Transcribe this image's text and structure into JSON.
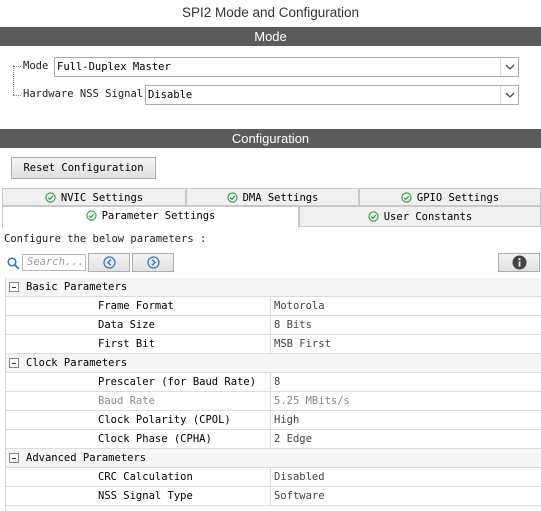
{
  "window": {
    "title": "SPI2 Mode and Configuration"
  },
  "mode_section": {
    "header": "Mode",
    "mode_label": "Mode",
    "mode_value": "Full-Duplex Master",
    "nss_label": "Hardware NSS Signal",
    "nss_value": "Disable"
  },
  "config_section": {
    "header": "Configuration",
    "reset_button": "Reset Configuration",
    "tabs_top": [
      {
        "label": "NVIC Settings"
      },
      {
        "label": "DMA Settings"
      },
      {
        "label": "GPIO Settings"
      }
    ],
    "tabs_bottom": [
      {
        "label": "Parameter Settings",
        "active": true
      },
      {
        "label": "User Constants",
        "active": false
      }
    ],
    "instructions": "Configure the below parameters :",
    "search_placeholder": "Search...",
    "groups": [
      {
        "name": "Basic Parameters",
        "params": [
          {
            "name": "Frame Format",
            "value": "Motorola"
          },
          {
            "name": "Data Size",
            "value": "8 Bits"
          },
          {
            "name": "First Bit",
            "value": "MSB First"
          }
        ]
      },
      {
        "name": "Clock Parameters",
        "params": [
          {
            "name": "Prescaler (for Baud Rate)",
            "value": "8"
          },
          {
            "name": "Baud Rate",
            "value": "5.25 MBits/s",
            "readonly": true
          },
          {
            "name": "Clock Polarity (CPOL)",
            "value": "High"
          },
          {
            "name": "Clock Phase (CPHA)",
            "value": "2 Edge"
          }
        ]
      },
      {
        "name": "Advanced Parameters",
        "params": [
          {
            "name": "CRC Calculation",
            "value": "Disabled"
          },
          {
            "name": "NSS Signal Type",
            "value": "Software"
          }
        ]
      }
    ]
  },
  "colors": {
    "header_bar": "#5b5b5b",
    "check_icon": "#2e9c4a",
    "nav_arrow": "#2a78c8"
  }
}
